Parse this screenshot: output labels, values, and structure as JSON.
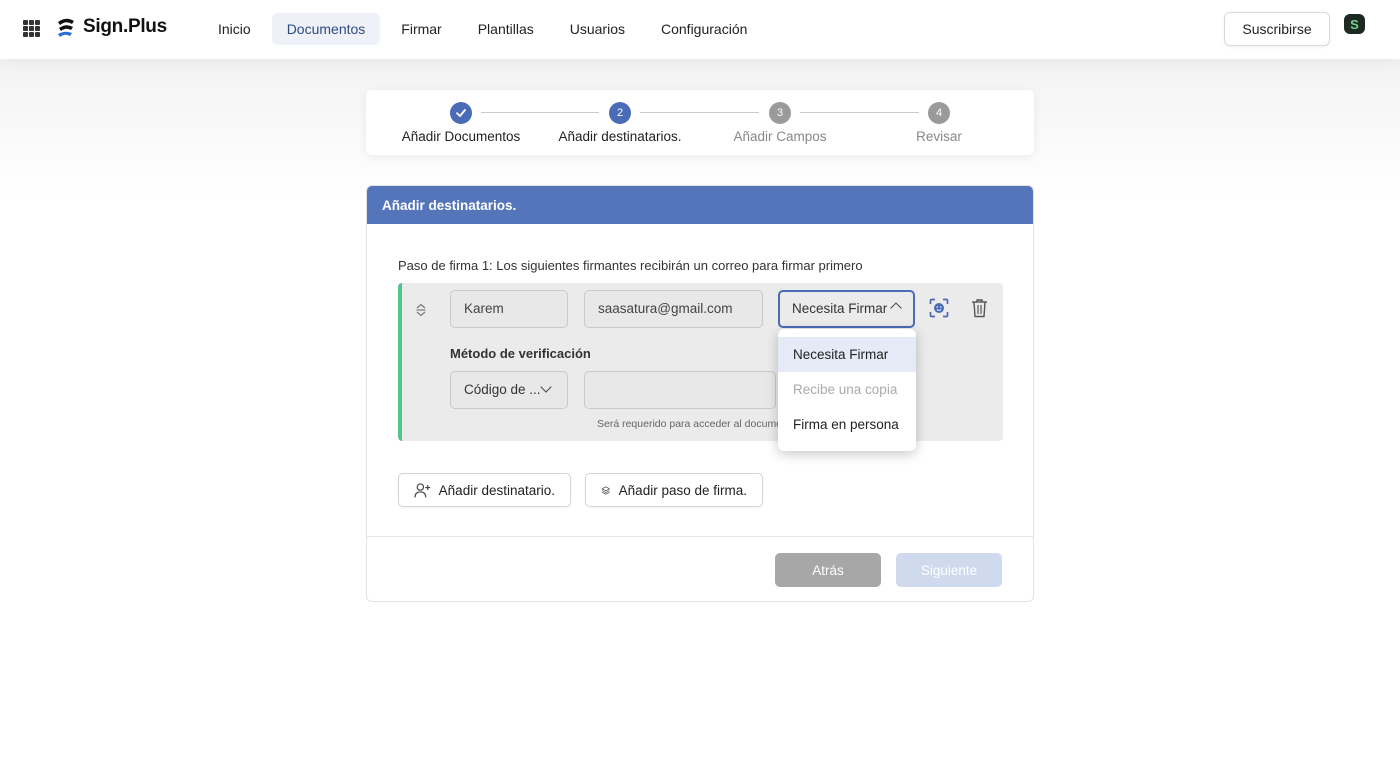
{
  "header": {
    "logo_text": "Sign.Plus",
    "nav": [
      {
        "label": "Inicio",
        "active": false
      },
      {
        "label": "Documentos",
        "active": true
      },
      {
        "label": "Firmar",
        "active": false
      },
      {
        "label": "Plantillas",
        "active": false
      },
      {
        "label": "Usuarios",
        "active": false
      },
      {
        "label": "Configuración",
        "active": false
      }
    ],
    "subscribe_label": "Suscribirse",
    "avatar_letter": "S"
  },
  "stepper": {
    "steps": [
      {
        "number": "1",
        "label": "Añadir Documentos",
        "state": "done"
      },
      {
        "number": "2",
        "label": "Añadir destinatarios.",
        "state": "current"
      },
      {
        "number": "3",
        "label": "Añadir Campos",
        "state": "todo"
      },
      {
        "number": "4",
        "label": "Revisar",
        "state": "todo"
      }
    ]
  },
  "card": {
    "title": "Añadir destinatarios.",
    "step_description": "Paso de firma 1: Los siguientes firmantes recibirán un correo para firmar primero",
    "recipient": {
      "name": "Karem",
      "email": "saasatura@gmail.com",
      "role": "Necesita Firmar",
      "verification_label": "Método de verificación",
      "verification_method": "Código de ...",
      "verification_value": "",
      "verification_hint": "Será requerido para acceder al documento"
    },
    "role_options": [
      {
        "label": "Necesita Firmar",
        "state": "selected"
      },
      {
        "label": "Recibe una copia",
        "state": "disabled"
      },
      {
        "label": "Firma en persona",
        "state": "normal"
      }
    ],
    "add_recipient_label": "Añadir destinatario.",
    "add_step_label": "Añadir paso de firma.",
    "back_label": "Atrás",
    "next_label": "Siguiente"
  },
  "colors": {
    "accent": "#4a6bb5",
    "header_bar": "#5575ba",
    "recipient_border": "#56c28f"
  }
}
